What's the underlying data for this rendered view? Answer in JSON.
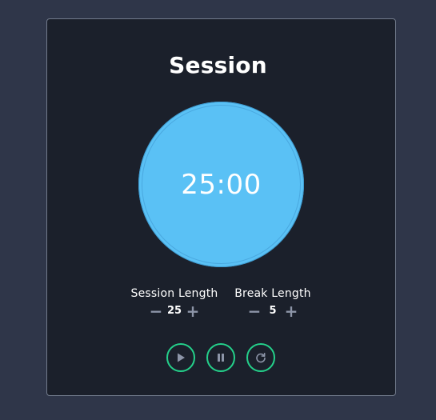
{
  "title": "Session",
  "timer": {
    "display": "25:00"
  },
  "session": {
    "label": "Session Length",
    "value": "25",
    "decrement": "−",
    "increment": "+"
  },
  "break": {
    "label": "Break Length",
    "value": "5",
    "decrement": "−",
    "increment": "+"
  },
  "controls": {
    "play_icon": "play-icon",
    "pause_icon": "pause-icon",
    "reset_icon": "reset-icon"
  },
  "colors": {
    "background": "#2f3649",
    "card": "#1b202b",
    "card_border": "#727b8c",
    "timer": "#5ac1f5",
    "accent": "#24d08a",
    "control_icon": "#8d95a8"
  }
}
